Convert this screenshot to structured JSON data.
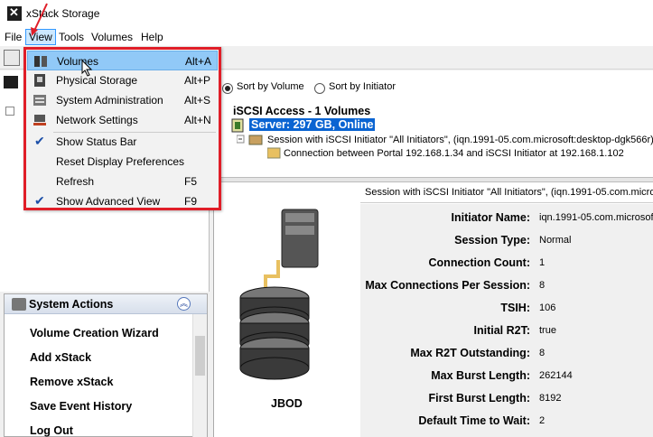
{
  "app": {
    "title": "xStack Storage"
  },
  "menubar": [
    "File",
    "View",
    "Tools",
    "Volumes",
    "Help"
  ],
  "view_menu": {
    "items": [
      {
        "label": "Volumes",
        "shortcut": "Alt+A",
        "icon": "volumes-icon",
        "highlighted": true
      },
      {
        "label": "Physical Storage",
        "shortcut": "Alt+P",
        "icon": "physical-storage-icon"
      },
      {
        "label": "System Administration",
        "shortcut": "Alt+S",
        "icon": "system-admin-icon"
      },
      {
        "label": "Network Settings",
        "shortcut": "Alt+N",
        "icon": "network-settings-icon"
      },
      {
        "label": "Show Status Bar",
        "shortcut": "",
        "checked": true
      },
      {
        "label": "Reset Display Preferences",
        "shortcut": ""
      },
      {
        "label": "Refresh",
        "shortcut": "F5"
      },
      {
        "label": "Show Advanced View",
        "shortcut": "F9",
        "checked": true
      }
    ]
  },
  "system_actions": {
    "title": "System Actions",
    "items": [
      "Volume Creation Wizard",
      "Add xStack",
      "Remove xStack",
      "Save Event History",
      "Log Out"
    ]
  },
  "sort": {
    "by_volume": "Sort by Volume",
    "by_initiator": "Sort by Initiator",
    "selected": "by_volume"
  },
  "tree": {
    "iscsi_title": "iSCSI Access - 1 Volumes",
    "server": "Server: 297 GB, Online",
    "session": "Session with iSCSI Initiator \"All Initiators\", (iqn.1991-05.com.microsoft:desktop-dgk566r)",
    "connection": "Connection between Portal 192.168.1.34 and iSCSI Initiator at 192.168.1.102"
  },
  "detail": {
    "header": "Session with iSCSI Initiator \"All Initiators\", (iqn.1991-05.com.microso",
    "properties": [
      {
        "label": "Initiator Name:",
        "value": "iqn.1991-05.com.microsof"
      },
      {
        "label": "Session Type:",
        "value": "Normal"
      },
      {
        "label": "Connection Count:",
        "value": "1"
      },
      {
        "label": "Max Connections Per Session:",
        "value": "8"
      },
      {
        "label": "TSIH:",
        "value": "106"
      },
      {
        "label": "Initial R2T:",
        "value": "true"
      },
      {
        "label": "Max R2T Outstanding:",
        "value": "8"
      },
      {
        "label": "Max Burst Length:",
        "value": "262144"
      },
      {
        "label": "First Burst Length:",
        "value": "8192"
      },
      {
        "label": "Default Time to Wait:",
        "value": "2"
      }
    ],
    "jbod_label": "JBOD"
  },
  "colors": {
    "menu_border": "#e01e28",
    "selection": "#0a64d2",
    "highlight": "#91c9f7"
  }
}
